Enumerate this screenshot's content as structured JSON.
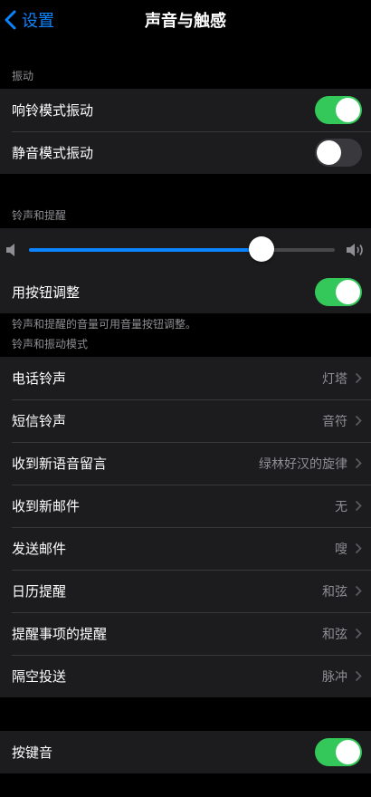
{
  "nav": {
    "back_label": "设置",
    "title": "声音与触感"
  },
  "vibration": {
    "header": "振动",
    "rows": [
      {
        "label": "响铃模式振动",
        "on": true
      },
      {
        "label": "静音模式振动",
        "on": false
      }
    ]
  },
  "ringer": {
    "header": "铃声和提醒",
    "volume": 0.76,
    "button_adjust_label": "用按钮调整",
    "button_adjust_on": true,
    "footer": "铃声和提醒的音量可用音量按钮调整。"
  },
  "patterns": {
    "header": "铃声和振动模式",
    "rows": [
      {
        "label": "电话铃声",
        "value": "灯塔"
      },
      {
        "label": "短信铃声",
        "value": "音符"
      },
      {
        "label": "收到新语音留言",
        "value": "绿林好汉的旋律"
      },
      {
        "label": "收到新邮件",
        "value": "无"
      },
      {
        "label": "发送邮件",
        "value": "嗖"
      },
      {
        "label": "日历提醒",
        "value": "和弦"
      },
      {
        "label": "提醒事项的提醒",
        "value": "和弦"
      },
      {
        "label": "隔空投送",
        "value": "脉冲"
      }
    ]
  },
  "keyboard": {
    "label": "按键音",
    "on": true
  },
  "colors": {
    "accent": "#0a84ff",
    "toggle_on": "#34c759",
    "background": "#000000",
    "cell": "#1c1c1e"
  }
}
